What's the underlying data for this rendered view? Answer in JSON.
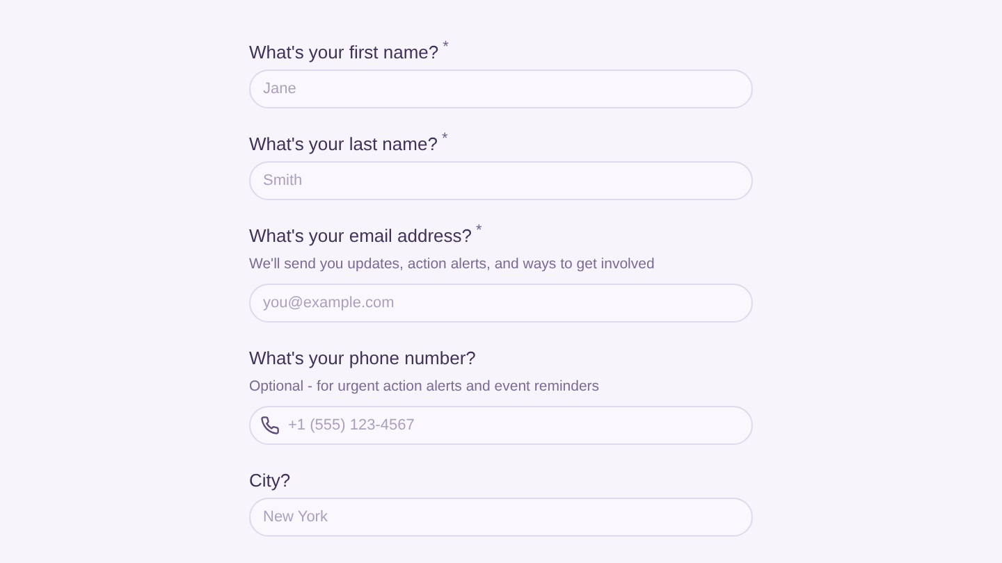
{
  "fields": [
    {
      "label": "What's your first name?",
      "required_mark": "*",
      "placeholder": "Jane"
    },
    {
      "label": "What's your last name?",
      "required_mark": "*",
      "placeholder": "Smith"
    },
    {
      "label": "What's your email address?",
      "required_mark": "*",
      "hint": "We'll send you updates, action alerts, and ways to get involved",
      "placeholder": "you@example.com"
    },
    {
      "label": "What's your phone number?",
      "hint": "Optional - for urgent action alerts and event reminders",
      "placeholder": "+1 (555) 123-4567",
      "kind": "phone"
    },
    {
      "label": "City?",
      "placeholder": "New York"
    }
  ]
}
